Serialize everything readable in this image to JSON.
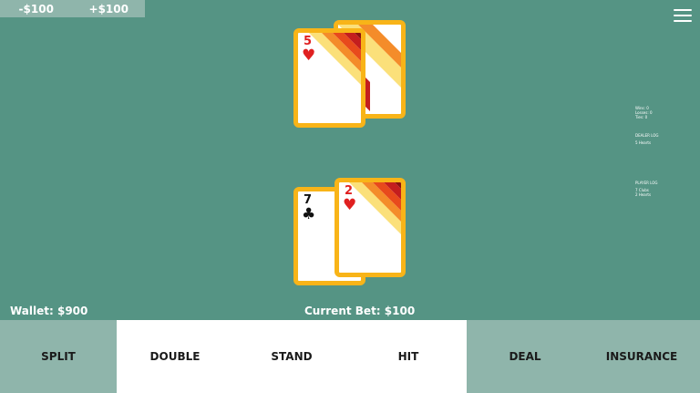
{
  "bet_adjust": {
    "decrease_label": "-$100",
    "increase_label": "+$100"
  },
  "dealer_hand": {
    "cards": [
      {
        "rank": "5",
        "suit": "♥",
        "color": "red"
      }
    ],
    "hidden_cards": 1
  },
  "player_hand": {
    "cards": [
      {
        "rank": "7",
        "suit": "♣",
        "color": "black"
      },
      {
        "rank": "2",
        "suit": "♥",
        "color": "red"
      }
    ]
  },
  "log": {
    "wins": "Wins: 0",
    "losses": "Losses: 0",
    "ties": "Ties: 0",
    "dealer_title": "DEALER LOG",
    "dealer_entry": "5 Hearts",
    "player_title": "PLAYER LOG",
    "player_entries": [
      "7 Clubs",
      "2 Hearts"
    ]
  },
  "wallet_label": "Wallet: $900",
  "current_bet_label": "Current Bet: $100",
  "actions": {
    "split": "SPLIT",
    "double": "DOUBLE",
    "stand": "STAND",
    "hit": "HIT",
    "deal": "DEAL",
    "insurance": "INSURANCE"
  },
  "colors": {
    "table": "#559484",
    "button_muted": "#8fb5ab",
    "card_border": "#f8b418",
    "suit_red": "#e02020",
    "stripe_colors": [
      "#fbe07a",
      "#f48c2a",
      "#e84a1c",
      "#c41e1e",
      "#8c1010"
    ]
  },
  "icons": {
    "menu": "hamburger-menu-icon"
  }
}
